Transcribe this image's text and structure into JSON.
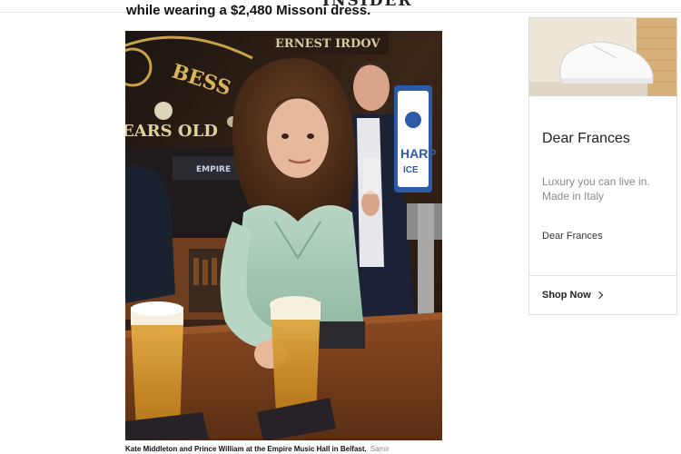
{
  "site": {
    "logo_text": "INSIDER"
  },
  "article": {
    "headline": "while wearing a $2,480 Missoni dress.",
    "photo": {
      "description_icon": "photo-kate-william-pub",
      "signage": [
        "BESS",
        "ERNEST IRDOV",
        "EARS OLD",
        "EMPIRE",
        "HARP",
        "ICE"
      ]
    },
    "caption": {
      "text": "Kate Middleton and Prince William at the Empire Music Hall in Belfast.",
      "credit": "Samir"
    }
  },
  "ad": {
    "brand": "Dear Frances",
    "description": "Luxury you can live in. Made in Italy",
    "sub_brand": "Dear Frances",
    "cta_label": "Shop Now"
  }
}
